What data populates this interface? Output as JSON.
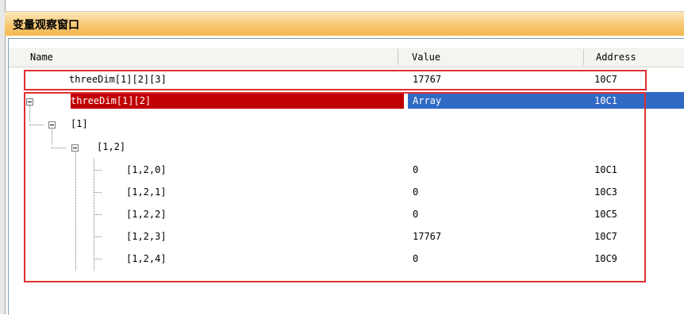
{
  "window": {
    "title": "变量观察窗口"
  },
  "columns": {
    "name": "Name",
    "value": "Value",
    "address": "Address"
  },
  "rows": [
    {
      "name": "threeDim[1][2][3]",
      "value": "17767",
      "address": "10C7"
    },
    {
      "name": "threeDim[1][2]",
      "value": "Array",
      "address": "10C1"
    },
    {
      "name": "[1]",
      "value": "",
      "address": ""
    },
    {
      "name": "[1,2]",
      "value": "",
      "address": ""
    },
    {
      "name": "[1,2,0]",
      "value": "0",
      "address": "10C1"
    },
    {
      "name": "[1,2,1]",
      "value": "0",
      "address": "10C3"
    },
    {
      "name": "[1,2,2]",
      "value": "0",
      "address": "10C5"
    },
    {
      "name": "[1,2,3]",
      "value": "17767",
      "address": "10C7"
    },
    {
      "name": "[1,2,4]",
      "value": "0",
      "address": "10C9"
    }
  ],
  "colors": {
    "selection_name": "#c00000",
    "selection_value": "#316ac5",
    "highlight_box": "#e03030"
  }
}
